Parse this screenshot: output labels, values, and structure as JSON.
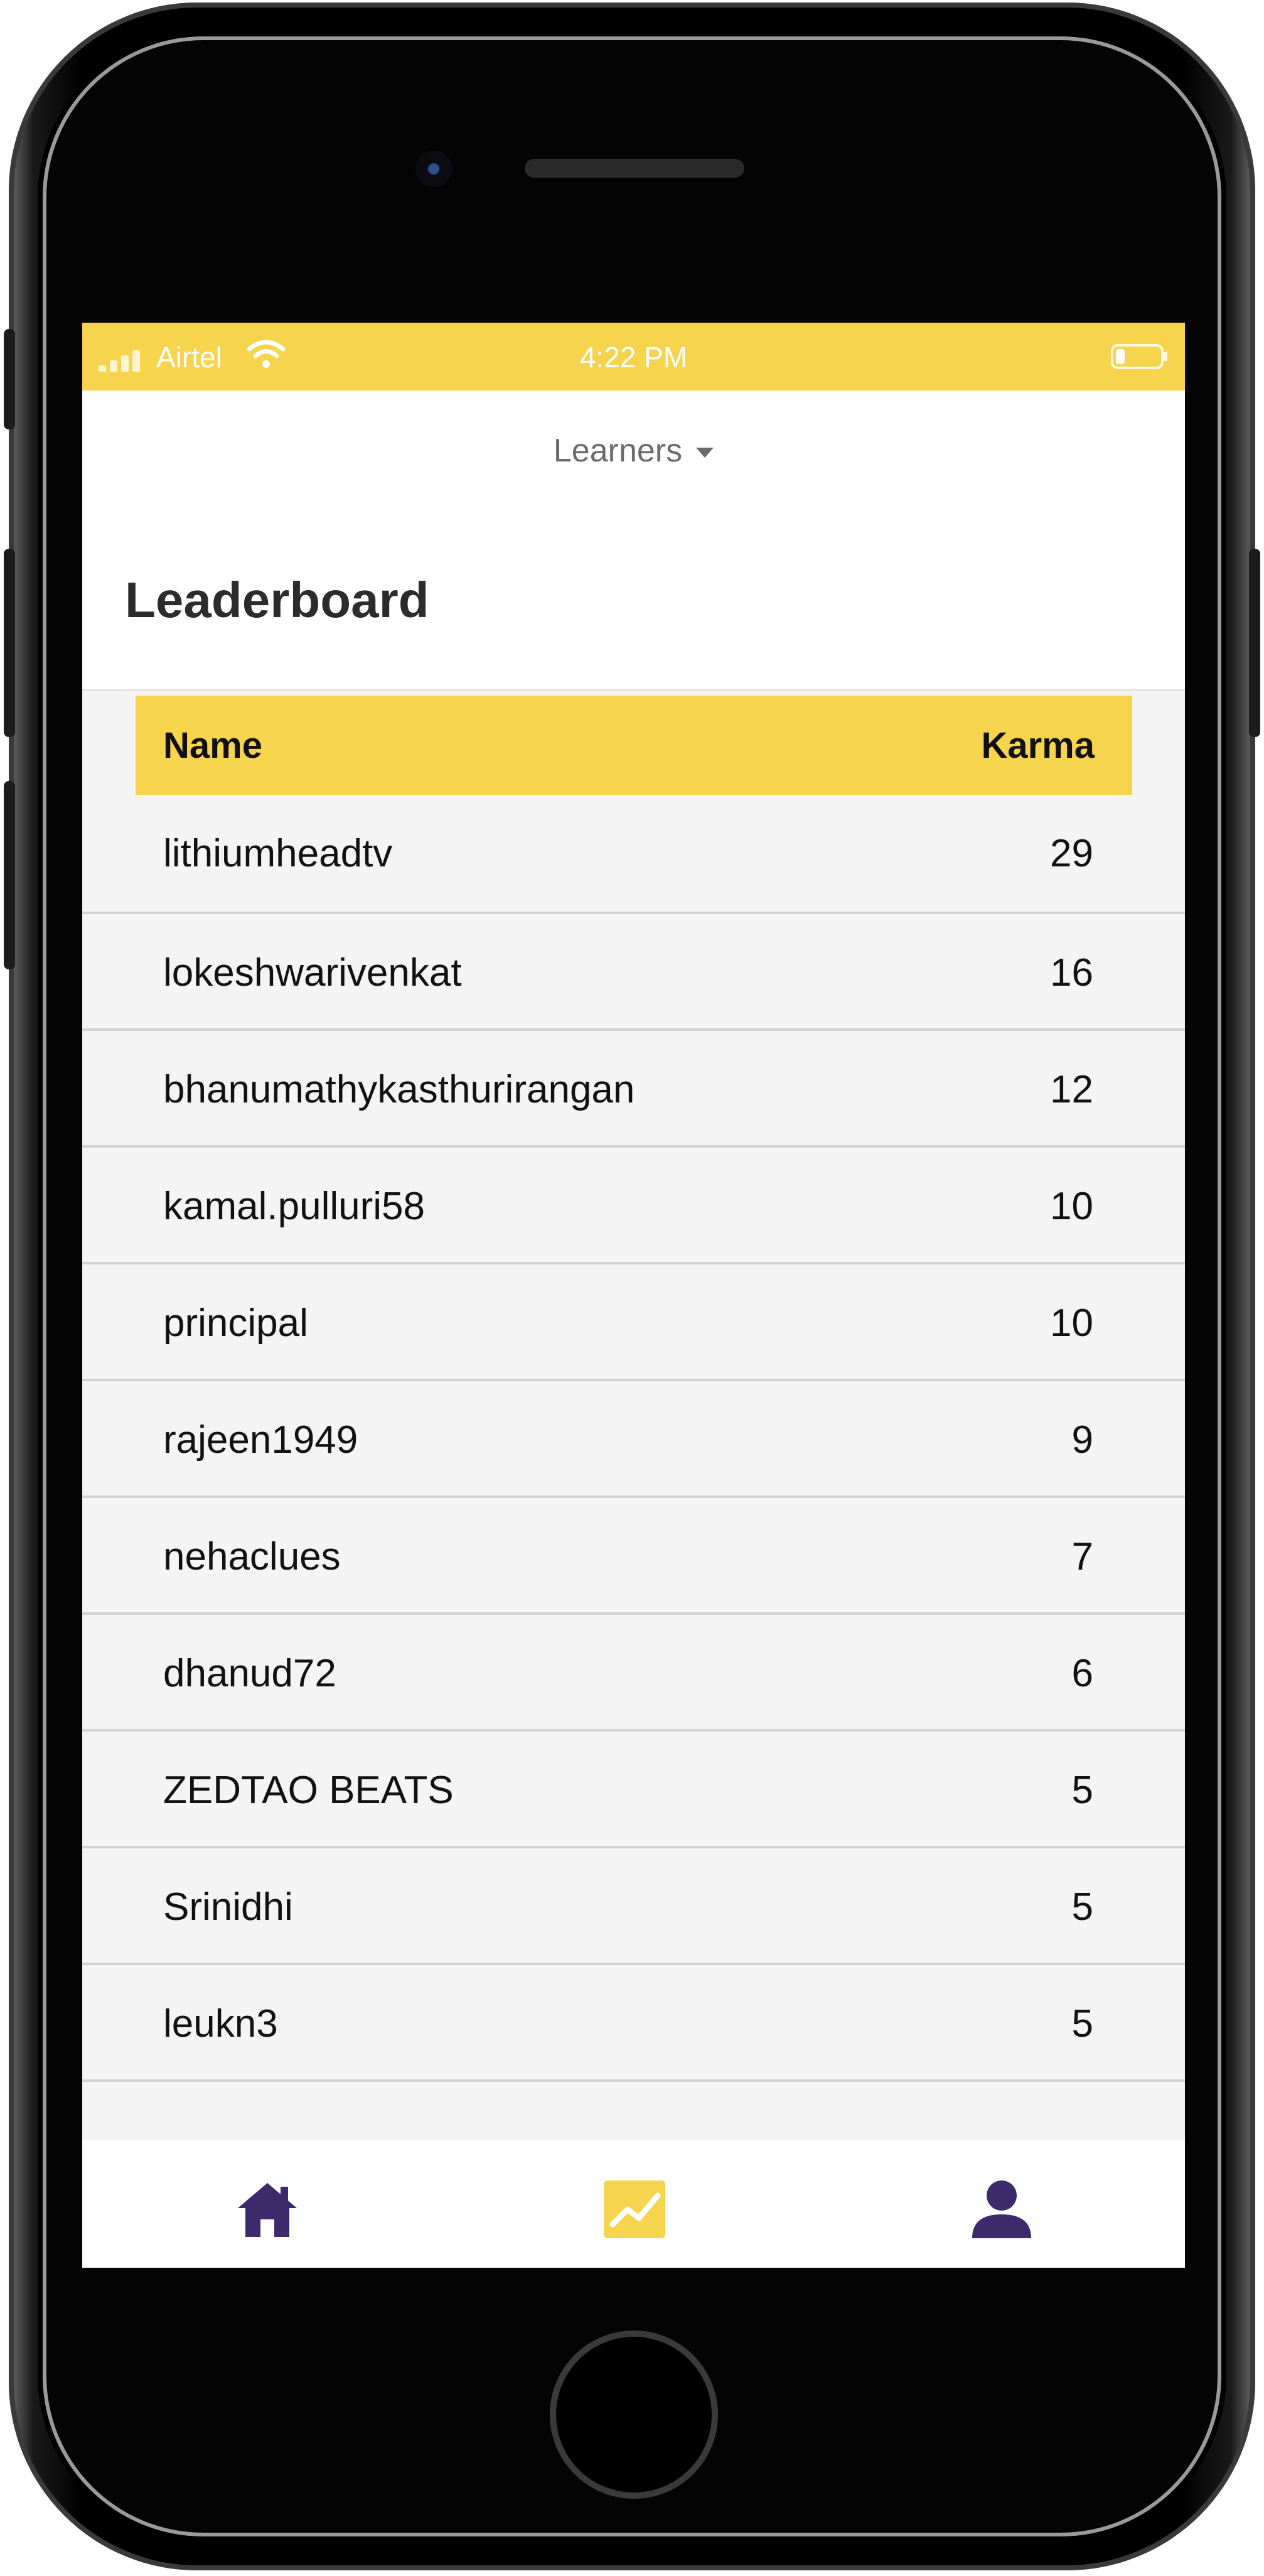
{
  "status_bar": {
    "carrier": "Airtel",
    "time": "4:22 PM"
  },
  "header": {
    "filter_label": "Learners",
    "title": "Leaderboard"
  },
  "table": {
    "columns": {
      "name": "Name",
      "karma": "Karma"
    },
    "rows": [
      {
        "name": "lithiumheadtv",
        "karma": "29"
      },
      {
        "name": "lokeshwarivenkat",
        "karma": "16"
      },
      {
        "name": "bhanumathykasthurirangan",
        "karma": "12"
      },
      {
        "name": "kamal.pulluri58",
        "karma": "10"
      },
      {
        "name": "principal",
        "karma": "10"
      },
      {
        "name": "rajeen1949",
        "karma": "9"
      },
      {
        "name": "nehaclues",
        "karma": "7"
      },
      {
        "name": "dhanud72",
        "karma": "6"
      },
      {
        "name": "ZEDTAO BEATS",
        "karma": "5"
      },
      {
        "name": "Srinidhi",
        "karma": "5"
      },
      {
        "name": "leukn3",
        "karma": "5"
      }
    ]
  },
  "tab_bar": {
    "items": [
      {
        "icon": "home-icon",
        "active": false
      },
      {
        "icon": "chart-icon",
        "active": true
      },
      {
        "icon": "user-icon",
        "active": false
      }
    ],
    "active_color": "#f6d44e",
    "inactive_color": "#3d2a6b"
  },
  "colors": {
    "accent": "#f6d44e",
    "row_background": "#f4f4f4"
  }
}
